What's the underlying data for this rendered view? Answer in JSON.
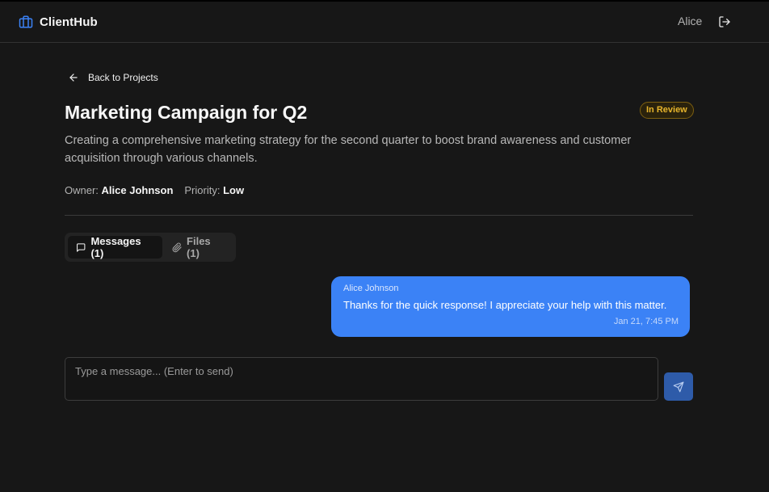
{
  "header": {
    "brand": "ClientHub",
    "brand_icon": "briefcase-icon",
    "user_name": "Alice",
    "logout_icon": "logout-icon"
  },
  "nav": {
    "back_label": "Back to Projects",
    "back_icon": "arrow-left-icon"
  },
  "project": {
    "title": "Marketing Campaign for Q2",
    "status": "In Review",
    "description": "Creating a comprehensive marketing strategy for the second quarter to boost brand awareness and customer acquisition through various channels.",
    "owner_label": "Owner:",
    "owner": "Alice Johnson",
    "priority_label": "Priority:",
    "priority": "Low"
  },
  "tabs": [
    {
      "label": "Messages (1)",
      "icon": "message-square-icon",
      "active": true
    },
    {
      "label": "Files (1)",
      "icon": "paperclip-icon",
      "active": false
    }
  ],
  "messages": [
    {
      "author": "Alice Johnson",
      "text": "Thanks for the quick response! I appreciate your help with this matter.",
      "time": "Jan 21, 7:45 PM"
    }
  ],
  "composer": {
    "placeholder": "Type a message... (Enter to send)",
    "value": "",
    "send_icon": "send-icon"
  },
  "colors": {
    "background": "#171717",
    "accent": "#3b82f6",
    "status_badge": "#e7b52c",
    "send_button": "#2e5ba9"
  }
}
